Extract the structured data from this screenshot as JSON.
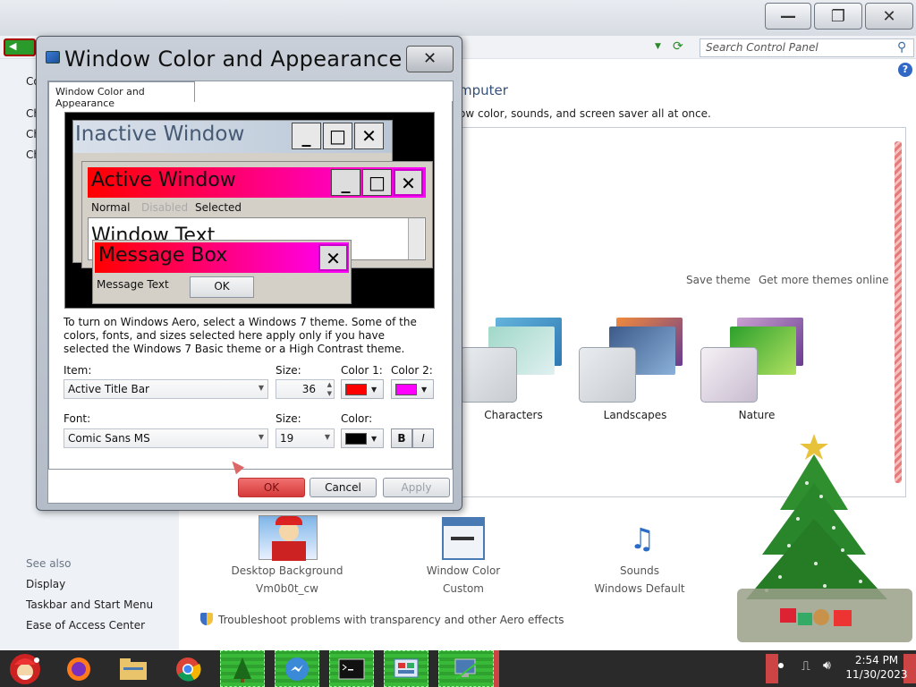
{
  "parent_window": {
    "search_placeholder": "Search Control Panel",
    "help_label": "?",
    "main_title": "mputer",
    "main_subtitle": "ow color, sounds, and screen saver all at once.",
    "sidebar_partial": [
      "Co",
      "Ch",
      "Ch",
      "Ch"
    ],
    "links": {
      "save_theme": "Save theme",
      "get_more": "Get more themes online"
    },
    "themes": [
      "Characters",
      "Landscapes",
      "Nature"
    ],
    "see_also": {
      "heading": "See also",
      "items": [
        "Display",
        "Taskbar and Start Menu",
        "Ease of Access Center"
      ]
    },
    "bottom_items": [
      {
        "title": "Desktop Background",
        "sub": "Vm0b0t_cw"
      },
      {
        "title": "Window Color",
        "sub": "Custom"
      },
      {
        "title": "Sounds",
        "sub": "Windows Default"
      }
    ],
    "troubleshoot": "Troubleshoot problems with transparency and other Aero effects",
    "caption_buttons": {
      "minimize": "—",
      "restore": "❐",
      "close": "✕"
    }
  },
  "dialog": {
    "title": "Window Color and Appearance",
    "tab": "Window Color and Appearance",
    "close_glyph": "✕",
    "preview": {
      "inactive_title": "Inactive Window",
      "active_title": "Active Window",
      "menu": [
        "Normal",
        "Disabled",
        "Selected"
      ],
      "window_text": "Window Text",
      "message_box_title": "Message Box",
      "message_text": "Message Text",
      "ok": "OK",
      "btn_min": "_",
      "btn_max": "□",
      "btn_close": "✕"
    },
    "info": "To turn on Windows Aero, select a Windows 7 theme.  Some of the colors, fonts, and sizes selected here apply only if you have selected the Windows 7 Basic theme or a High Contrast theme.",
    "item": {
      "label": "Item:",
      "value": "Active Title Bar"
    },
    "item_size": {
      "label": "Size:",
      "value": "36"
    },
    "color1": {
      "label": "Color 1:",
      "color": "#ff0000"
    },
    "color2": {
      "label": "Color 2:",
      "color": "#ff00ff"
    },
    "font": {
      "label": "Font:",
      "value": "Comic Sans MS"
    },
    "font_size": {
      "label": "Size:",
      "value": "19"
    },
    "font_color": {
      "label": "Color:",
      "color": "#000000"
    },
    "bold": "B",
    "italic": "I",
    "buttons": {
      "ok": "OK",
      "cancel": "Cancel",
      "apply": "Apply"
    }
  },
  "taskbar": {
    "time": "2:54 PM",
    "date": "11/30/2023",
    "apps": [
      "start",
      "firefox",
      "file-explorer",
      "chrome",
      "christmas-tree",
      "messenger",
      "command-prompt",
      "control-panel",
      "network"
    ]
  },
  "colors": {
    "accent_red": "#ff0000",
    "accent_magenta": "#ff00ff",
    "taskbar_green": "#38b938"
  }
}
